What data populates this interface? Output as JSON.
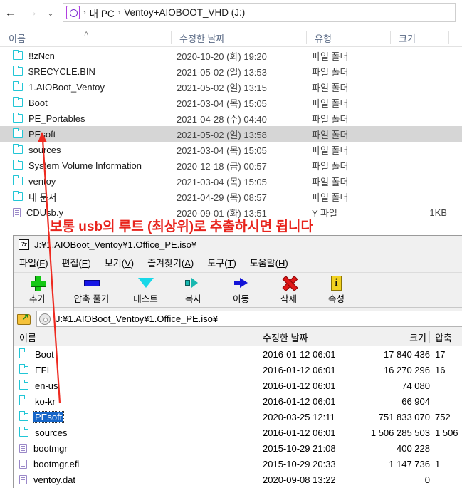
{
  "explorer": {
    "nav": {
      "back_icon": "arrow-left-icon",
      "forward_icon": "arrow-right-icon",
      "recent_icon": "chevron-down-icon",
      "up_icon": "arrow-up-icon"
    },
    "address": {
      "icon": "drive-icon",
      "crumbs": [
        "내 PC",
        "Ventoy+AIOBOOT_VHD (J:)"
      ],
      "separator": "›"
    },
    "columns": [
      {
        "label": "이름",
        "sorted": "asc"
      },
      {
        "label": "수정한 날짜"
      },
      {
        "label": "유형"
      },
      {
        "label": "크기"
      }
    ],
    "sort_caret": "˄",
    "rows": [
      {
        "icon": "folder-icon",
        "name": "!!zNcn",
        "date": "2020-10-20 (화) 19:20",
        "type": "파일 폴더",
        "size": "",
        "selected": false
      },
      {
        "icon": "folder-icon",
        "name": "$RECYCLE.BIN",
        "date": "2021-05-02 (일) 13:53",
        "type": "파일 폴더",
        "size": "",
        "selected": false
      },
      {
        "icon": "folder-icon",
        "name": "1.AIOBoot_Ventoy",
        "date": "2021-05-02 (일) 13:15",
        "type": "파일 폴더",
        "size": "",
        "selected": false
      },
      {
        "icon": "folder-icon",
        "name": "Boot",
        "date": "2021-03-04 (목) 15:05",
        "type": "파일 폴더",
        "size": "",
        "selected": false
      },
      {
        "icon": "folder-icon",
        "name": "PE_Portables",
        "date": "2021-04-28 (수) 04:40",
        "type": "파일 폴더",
        "size": "",
        "selected": false
      },
      {
        "icon": "folder-icon",
        "name": "PEsoft",
        "date": "2021-05-02 (일) 13:58",
        "type": "파일 폴더",
        "size": "",
        "selected": true
      },
      {
        "icon": "folder-icon",
        "name": "sources",
        "date": "2021-03-04 (목) 15:05",
        "type": "파일 폴더",
        "size": "",
        "selected": false
      },
      {
        "icon": "folder-icon",
        "name": "System Volume Information",
        "date": "2020-12-18 (금) 00:57",
        "type": "파일 폴더",
        "size": "",
        "selected": false
      },
      {
        "icon": "folder-icon",
        "name": "ventoy",
        "date": "2021-03-04 (목) 15:05",
        "type": "파일 폴더",
        "size": "",
        "selected": false
      },
      {
        "icon": "folder-icon",
        "name": "내 문서",
        "date": "2021-04-29 (목) 08:57",
        "type": "파일 폴더",
        "size": "",
        "selected": false
      },
      {
        "icon": "file-icon",
        "name": "CDUsb.y",
        "date": "2020-09-01 (화) 13:51",
        "type": "Y 파일",
        "size": "1KB",
        "selected": false
      }
    ]
  },
  "annotation": {
    "text": "보통 usb의 루트 (최상위)로 추출하시면 됩니다",
    "color": "#e8231c",
    "arrow_icon": "arrow-up-annotation-icon"
  },
  "sevenzip": {
    "logo_text": "7z",
    "title": "J:¥1.AIOBoot_Ventoy¥1.Office_PE.iso¥",
    "menu": [
      {
        "label": "파일(",
        "accel": "F",
        "tail": ")"
      },
      {
        "label": "편집(",
        "accel": "E",
        "tail": ")"
      },
      {
        "label": "보기(",
        "accel": "V",
        "tail": ")"
      },
      {
        "label": "즐겨찾기(",
        "accel": "A",
        "tail": ")"
      },
      {
        "label": "도구(",
        "accel": "T",
        "tail": ")"
      },
      {
        "label": "도움말(",
        "accel": "H",
        "tail": ")"
      }
    ],
    "toolbar": [
      {
        "label": "추가",
        "icon": "plus-icon"
      },
      {
        "label": "압축 풀기",
        "icon": "extract-icon"
      },
      {
        "label": "테스트",
        "icon": "test-chevron-icon"
      },
      {
        "label": "복사",
        "icon": "copy-arrow-icon"
      },
      {
        "label": "이동",
        "icon": "move-arrow-icon"
      },
      {
        "label": "삭제",
        "icon": "delete-x-icon"
      },
      {
        "label": "속성",
        "icon": "info-icon"
      }
    ],
    "address": {
      "up_icon": "folder-up-icon",
      "disc_icon": "disc-icon",
      "path": "J:¥1.AIOBoot_Ventoy¥1.Office_PE.iso¥"
    },
    "columns": [
      "이름",
      "수정한 날짜",
      "크기",
      "압축"
    ],
    "rows": [
      {
        "icon": "folder-icon",
        "name": "Boot",
        "date": "2016-01-12 06:01",
        "size": "17 840 436",
        "packed": "17",
        "selected": false
      },
      {
        "icon": "folder-icon",
        "name": "EFI",
        "date": "2016-01-12 06:01",
        "size": "16 270 296",
        "packed": "16",
        "selected": false
      },
      {
        "icon": "folder-icon",
        "name": "en-us",
        "date": "2016-01-12 06:01",
        "size": "74 080",
        "packed": "",
        "selected": false
      },
      {
        "icon": "folder-icon",
        "name": "ko-kr",
        "date": "2016-01-12 06:01",
        "size": "66 904",
        "packed": "",
        "selected": false
      },
      {
        "icon": "folder-icon",
        "name": "PEsoft",
        "date": "2020-03-25 12:11",
        "size": "751 833 070",
        "packed": "752",
        "selected": true
      },
      {
        "icon": "folder-icon",
        "name": "sources",
        "date": "2016-01-12 06:01",
        "size": "1 506 285 503",
        "packed": "1 506",
        "selected": false
      },
      {
        "icon": "file-icon",
        "name": "bootmgr",
        "date": "2015-10-29 21:08",
        "size": "400 228",
        "packed": "",
        "selected": false
      },
      {
        "icon": "file-icon",
        "name": "bootmgr.efi",
        "date": "2015-10-29 20:33",
        "size": "1 147 736",
        "packed": "1",
        "selected": false
      },
      {
        "icon": "file-icon",
        "name": "ventoy.dat",
        "date": "2020-09-08 13:22",
        "size": "0",
        "packed": "",
        "selected": false
      }
    ]
  }
}
